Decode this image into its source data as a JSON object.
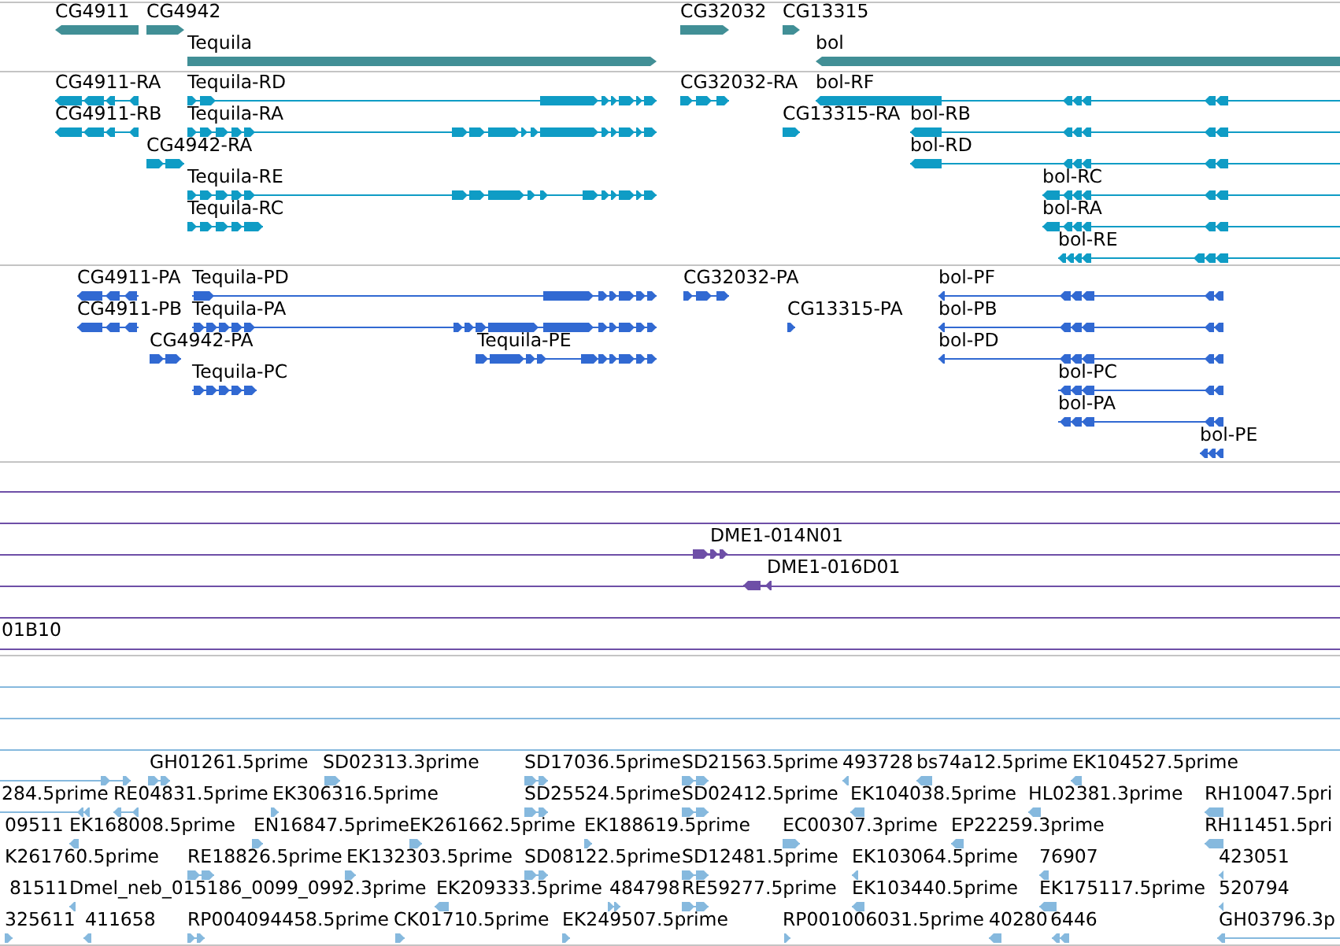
{
  "tracks": [
    {
      "kind": "gene",
      "rows": [
        {
          "features": [
            {
              "label": "CG4911",
              "reverse": true
            },
            {
              "label": "CG4942",
              "reverse": false
            },
            {
              "label": "CG32032",
              "reverse": false
            },
            {
              "label": "CG13315",
              "reverse": false
            }
          ]
        },
        {
          "features": [
            {
              "label": "Tequila",
              "reverse": false
            },
            {
              "label": "bol",
              "reverse": true
            }
          ]
        }
      ]
    },
    {
      "kind": "transcript",
      "rows": [
        {
          "features": [
            {
              "label": "CG4911-RA",
              "reverse": true
            },
            {
              "label": "Tequila-RD",
              "reverse": false
            },
            {
              "label": "CG32032-RA",
              "reverse": false
            },
            {
              "label": "bol-RF",
              "reverse": true
            }
          ]
        },
        {
          "features": [
            {
              "label": "CG4911-RB",
              "reverse": true
            },
            {
              "label": "Tequila-RA",
              "reverse": false
            },
            {
              "label": "CG13315-RA",
              "reverse": false
            },
            {
              "label": "bol-RB",
              "reverse": true
            }
          ]
        },
        {
          "features": [
            {
              "label": "CG4942-RA",
              "reverse": false
            },
            {
              "label": "bol-RD",
              "reverse": true
            }
          ]
        },
        {
          "features": [
            {
              "label": "Tequila-RE",
              "reverse": false
            },
            {
              "label": "bol-RC",
              "reverse": true
            }
          ]
        },
        {
          "features": [
            {
              "label": "Tequila-RC",
              "reverse": false
            },
            {
              "label": "bol-RA",
              "reverse": true
            }
          ]
        },
        {
          "features": [
            {
              "label": "bol-RE",
              "reverse": true
            }
          ]
        }
      ]
    },
    {
      "kind": "protein",
      "rows": [
        {
          "features": [
            {
              "label": "CG4911-PA",
              "reverse": true
            },
            {
              "label": "Tequila-PD",
              "reverse": false
            },
            {
              "label": "CG32032-PA",
              "reverse": false
            },
            {
              "label": "bol-PF",
              "reverse": true
            }
          ]
        },
        {
          "features": [
            {
              "label": "CG4911-PB",
              "reverse": true
            },
            {
              "label": "Tequila-PA",
              "reverse": false
            },
            {
              "label": "CG13315-PA",
              "reverse": false
            },
            {
              "label": "bol-PB",
              "reverse": true
            }
          ]
        },
        {
          "features": [
            {
              "label": "CG4942-PA",
              "reverse": false
            },
            {
              "label": "Tequila-PE",
              "reverse": false
            },
            {
              "label": "bol-PD",
              "reverse": true
            }
          ]
        },
        {
          "features": [
            {
              "label": "Tequila-PC",
              "reverse": false
            },
            {
              "label": "bol-PC",
              "reverse": true
            }
          ]
        },
        {
          "features": [
            {
              "label": "bol-PA",
              "reverse": true
            }
          ]
        },
        {
          "features": [
            {
              "label": "bol-PE",
              "reverse": true
            }
          ]
        }
      ]
    },
    {
      "kind": "clone",
      "rows": [
        {
          "through_line": true
        },
        {
          "through_line": true
        },
        {
          "through_line": true,
          "features": [
            {
              "label": "DME1-014N01",
              "reverse": false
            }
          ]
        },
        {
          "through_line": true,
          "features": [
            {
              "label": "DME1-016D01",
              "reverse": true
            }
          ]
        },
        {
          "through_line": true
        },
        {
          "through_line": true,
          "features": [
            {
              "label": "01B10"
            }
          ]
        }
      ]
    },
    {
      "kind": "est",
      "rows": [
        {
          "through_line": true
        },
        {
          "through_line": true
        },
        {
          "through_line": true
        },
        {
          "features": [
            {
              "reverse": false
            },
            {
              "label": "GH01261.5prime",
              "reverse": false
            },
            {
              "label": "SD02313.3prime",
              "reverse": false
            },
            {
              "label": "SD17036.5prime",
              "reverse": false
            },
            {
              "label": "SD21563.5prime",
              "reverse": false
            },
            {
              "label": "493728",
              "reverse": true
            },
            {
              "label": "bs74a12.5prime",
              "reverse": true
            },
            {
              "label": "EK104527.5prime",
              "reverse": true
            }
          ]
        },
        {
          "features": [
            {
              "label": "284.5prime",
              "reverse": true
            },
            {
              "label": "RE04831.5prime",
              "reverse": true
            },
            {
              "label": "EK306316.5prime",
              "reverse": false
            },
            {
              "label": "SD25524.5prime",
              "reverse": false
            },
            {
              "label": "SD02412.5prime",
              "reverse": false
            },
            {
              "label": "EK104038.5prime",
              "reverse": true
            },
            {
              "label": "HL02381.3prime",
              "reverse": true
            },
            {
              "label": "RH10047.5pri",
              "reverse": true
            }
          ]
        },
        {
          "features": [
            {
              "label": "09511"
            },
            {
              "label": "EK168008.5prime",
              "reverse": true
            },
            {
              "label": "EN16847.5prime",
              "reverse": false
            },
            {
              "label": "EK261662.5prime",
              "reverse": false
            },
            {
              "label": "EK188619.5prime",
              "reverse": false
            },
            {
              "label": "EC00307.3prime",
              "reverse": false
            },
            {
              "label": "EP22259.3prime",
              "reverse": true
            },
            {
              "label": "RH11451.5pri",
              "reverse": true
            }
          ]
        },
        {
          "features": [
            {
              "label": "K261760.5prime"
            },
            {
              "label": "RE18826.5prime",
              "reverse": false
            },
            {
              "label": "EK132303.5prime",
              "reverse": false
            },
            {
              "label": "SD08122.5prime",
              "reverse": false
            },
            {
              "label": "SD12481.5prime",
              "reverse": false
            },
            {
              "label": "EK103064.5prime",
              "reverse": true
            },
            {
              "label": "76907",
              "reverse": true
            },
            {
              "label": "423051",
              "reverse": true
            }
          ]
        },
        {
          "features": [
            {
              "label": "81511"
            },
            {
              "label": "Dmel_neb_015186_0099_0992.3prime",
              "reverse": true
            },
            {
              "label": "EK209333.5prime",
              "reverse": true
            },
            {
              "label": "484798",
              "reverse": false
            },
            {
              "label": "RE59277.5prime",
              "reverse": false
            },
            {
              "label": "EK103440.5prime",
              "reverse": true
            },
            {
              "label": "EK175117.5prime",
              "reverse": true
            },
            {
              "label": "520794",
              "reverse": true
            }
          ]
        },
        {
          "features": [
            {
              "label": "325611",
              "reverse": false
            },
            {
              "label": "411658",
              "reverse": true
            },
            {
              "label": "RP004094458.5prime",
              "reverse": false
            },
            {
              "label": "CK01710.5prime",
              "reverse": false
            },
            {
              "label": "EK249507.5prime",
              "reverse": false
            },
            {
              "label": "RP001006031.5prime",
              "reverse": false
            },
            {
              "label": "40280",
              "reverse": true
            },
            {
              "label": "6446",
              "reverse": true
            },
            {
              "label": "GH03796.3p",
              "reverse": true
            }
          ]
        }
      ]
    }
  ]
}
